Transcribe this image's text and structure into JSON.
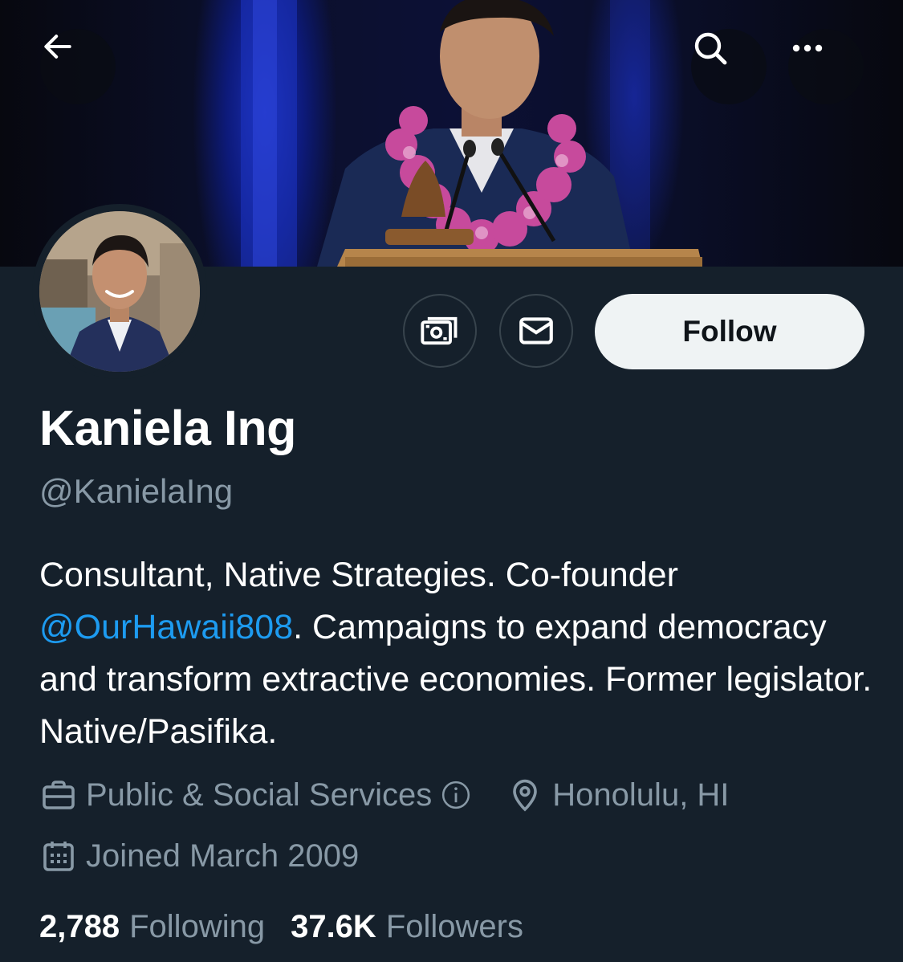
{
  "header": {
    "back_icon": "arrow-left-icon",
    "search_icon": "search-icon",
    "more_icon": "more-horizontal-icon"
  },
  "profile": {
    "name": "Kaniela Ing",
    "handle": "@KanielaIng",
    "follow_label": "Follow",
    "tip_icon": "money-icon",
    "message_icon": "envelope-icon",
    "bio": {
      "part1": "Consultant, Native Strategies. Co-founder ",
      "mention": "@OurHawaii808",
      "part2": ". Campaigns to expand democracy and transform extractive economies. Former legislator. Native/Pasifika."
    },
    "category": "Public & Social Services",
    "location": "Honolulu, HI",
    "joined": "Joined March 2009",
    "following_count": "2,788",
    "following_label": "Following",
    "followers_count": "37.6K",
    "followers_label": "Followers"
  },
  "colors": {
    "background": "#15202b",
    "mention": "#1d9bf0",
    "secondary_text": "#8899a6",
    "follow_button": "#eff3f4"
  }
}
